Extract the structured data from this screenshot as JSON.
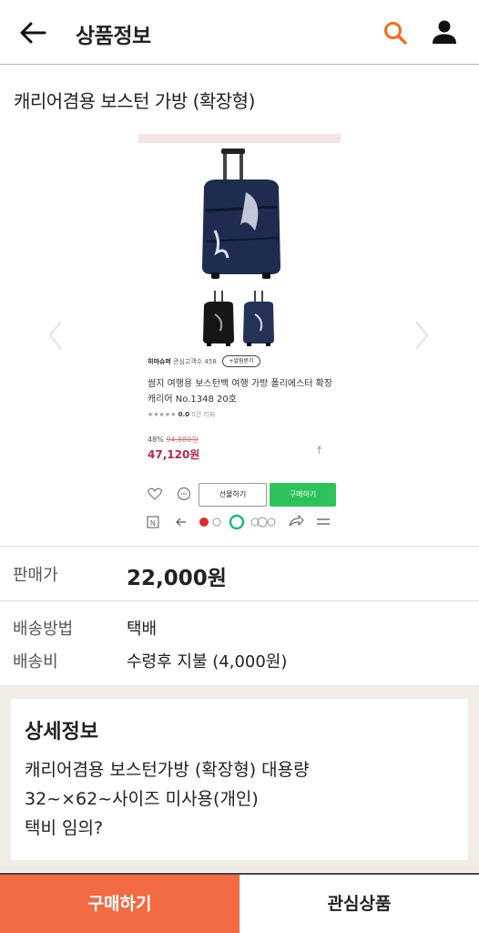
{
  "header": {
    "title": "상품정보",
    "back_icon": "arrow-left-icon",
    "search_icon": "search-icon",
    "user_icon": "user-icon",
    "accent_color": "#f26b21"
  },
  "product": {
    "name": "캐리어겸용 보스턴 가방 (확장형)"
  },
  "gallery": {
    "prev_icon": "chevron-left-icon",
    "next_icon": "chevron-right-icon",
    "screenshot": {
      "seller_name": "히마슈퍼",
      "seller_meta": "관심고객수 458",
      "follow_label": "+알림받기",
      "description": "쌈지 여행용 보스턴백 여행 가방 폴리에스터 확장 캐리어 No.1348 20호",
      "rating": "0.0",
      "review_count": "0건 리뷰",
      "discount": "48%",
      "original_price": "94,880원",
      "price": "47,120원",
      "gift_label": "선물하기",
      "buy_label": "구매하기"
    }
  },
  "info": {
    "price_label": "판매가",
    "price_value": "22,000원",
    "shipping_method_label": "배송방법",
    "shipping_method_value": "택배",
    "shipping_fee_label": "배송비",
    "shipping_fee_value": "수령후 지불 (4,000원)"
  },
  "detail": {
    "title": "상세정보",
    "lines": [
      "캐리어겸용 보스턴가방 (확장형) 대용량",
      "32~×62~사이즈 미사용(개인)",
      "택비 임의?"
    ]
  },
  "actions": {
    "buy_label": "구매하기",
    "wishlist_label": "관심상품",
    "buy_color": "#f26b43"
  }
}
